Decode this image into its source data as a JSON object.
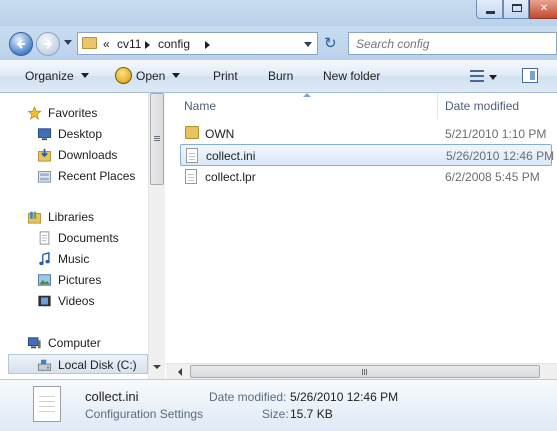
{
  "window": {
    "caption_buttons": [
      {
        "name": "minimize-icon"
      },
      {
        "name": "maximize-icon"
      },
      {
        "name": "close-icon",
        "glyph": "✕"
      }
    ]
  },
  "address_bar": {
    "overflow": "«",
    "path": [
      "cv11",
      "config"
    ],
    "refresh_glyph": "↻"
  },
  "search": {
    "placeholder": "Search config"
  },
  "toolbar": {
    "organize": "Organize",
    "open": "Open",
    "print": "Print",
    "burn": "Burn",
    "new_folder": "New folder"
  },
  "nav": {
    "items": [
      {
        "label": "Favorites",
        "icon": "star-icon"
      },
      {
        "label": "Desktop",
        "icon": "desktop-icon"
      },
      {
        "label": "Downloads",
        "icon": "downloads-icon"
      },
      {
        "label": "Recent Places",
        "icon": "recent-places-icon"
      },
      {
        "label": "Libraries",
        "icon": "libraries-icon"
      },
      {
        "label": "Documents",
        "icon": "documents-icon"
      },
      {
        "label": "Music",
        "icon": "music-icon"
      },
      {
        "label": "Pictures",
        "icon": "pictures-icon"
      },
      {
        "label": "Videos",
        "icon": "videos-icon"
      },
      {
        "label": "Computer",
        "icon": "computer-icon"
      },
      {
        "label": "Local Disk (C:)",
        "icon": "drive-icon",
        "selected": true
      }
    ]
  },
  "files": {
    "columns": {
      "name": "Name",
      "date": "Date modified"
    },
    "rows": [
      {
        "name": "OWN",
        "date": "5/21/2010 1:10 PM",
        "type": "folder"
      },
      {
        "name": "collect.ini",
        "date": "5/26/2010 12:46 PM",
        "type": "file",
        "selected": true
      },
      {
        "name": "collect.lpr",
        "date": "6/2/2008 5:45 PM",
        "type": "file"
      }
    ]
  },
  "details": {
    "name": "collect.ini",
    "type": "Configuration Settings",
    "date_label": "Date modified:",
    "date_value": "5/26/2010 12:46 PM",
    "size_label": "Size:",
    "size_value": "15.7 KB"
  },
  "colors": {
    "accent": "#84acdd",
    "selection": "#dbe8f8",
    "chrome": "#c9ddf1"
  }
}
